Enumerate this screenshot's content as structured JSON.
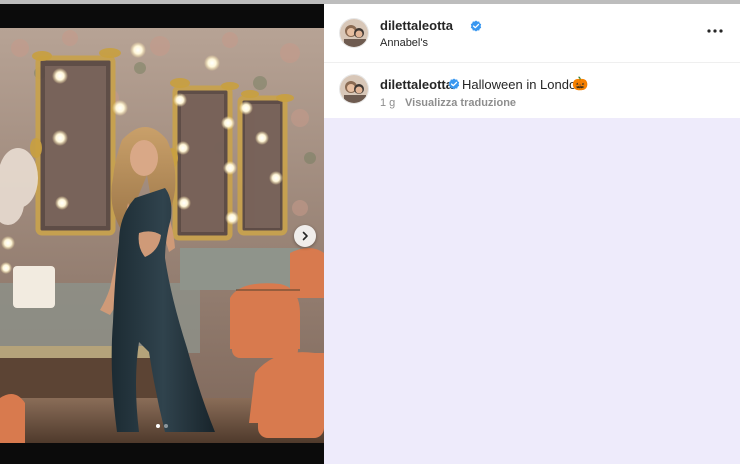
{
  "post": {
    "header": {
      "username": "dilettaleotta",
      "location": "Annabel's",
      "more_icon": "more-horizontal-icon"
    },
    "caption": {
      "username": "dilettaleotta",
      "text": "Halloween in London",
      "emoji": "🎃",
      "time_ago": "1 g",
      "translate_label": "Visualizza traduzione"
    },
    "media": {
      "next_icon": "chevron-right-icon",
      "slide_count": 2,
      "active_slide": 1
    }
  },
  "colors": {
    "verified_blue": "#3897f0",
    "right_background": "#eeebfb",
    "text_primary": "#262626",
    "text_secondary": "#8e8e8e"
  }
}
